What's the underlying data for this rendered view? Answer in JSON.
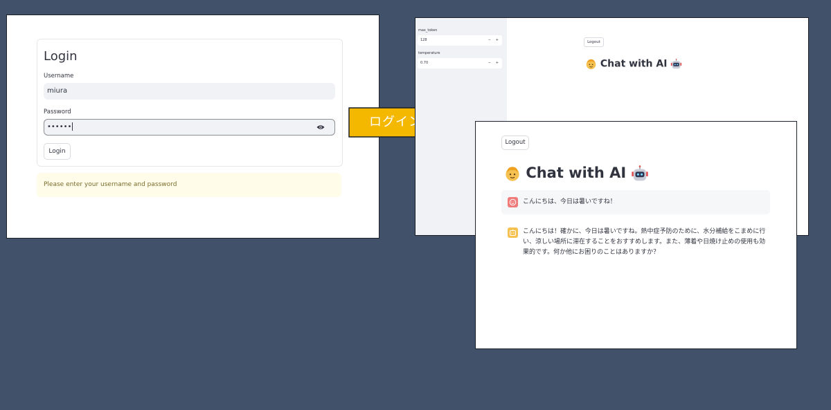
{
  "login": {
    "title": "Login",
    "username_label": "Username",
    "username_value": "miura",
    "password_label": "Password",
    "password_value": "••••••",
    "login_button": "Login",
    "warning": "Please enter your username and password"
  },
  "arrow": {
    "label": "ログイン",
    "color": "#f5b800"
  },
  "chat_back": {
    "sidebar": {
      "max_token_label": "max_token",
      "max_token_value": "128",
      "temperature_label": "temperature",
      "temperature_value": "0.70",
      "minus": "−",
      "plus": "+"
    },
    "logout": "Logout",
    "title": "Chat with AI"
  },
  "chat_front": {
    "logout": "Logout",
    "title": "Chat with AI",
    "messages": [
      {
        "role": "user",
        "avatar": "face-icon",
        "text": "こんにちは、今日は暑いですね！"
      },
      {
        "role": "assistant",
        "avatar": "bot-icon",
        "text": "こんにちは！確かに、今日は暑いですね。熱中症予防のために、水分補給をこまめに行い、涼しい場所に滞在することをおすすめします。また、薄着や日焼け止めの使用も効果的です。何か他にお困りのことはありますか？"
      }
    ]
  },
  "colors": {
    "background": "#415169",
    "arrow": "#f5b800",
    "user_avatar": "#f07b7b",
    "assistant_avatar": "#f5c150"
  }
}
